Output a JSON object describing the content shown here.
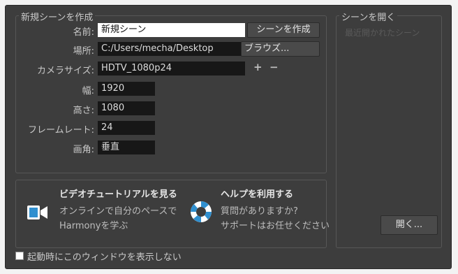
{
  "create_scene": {
    "group_title": "新規シーンを作成",
    "name_label": "名前:",
    "name_value": "新規シーン",
    "create_button": "シーンを作成",
    "location_label": "場所:",
    "location_value": "C:/Users/mecha/Desktop",
    "browse_button": "ブラウズ...",
    "camera_size_label": "カメラサイズ:",
    "camera_size_value": "HDTV_1080p24",
    "add_symbol": "+",
    "remove_symbol": "−",
    "width_label": "幅:",
    "width_value": "1920",
    "height_label": "高さ:",
    "height_value": "1080",
    "frame_rate_label": "フレームレート:",
    "frame_rate_value": "24",
    "angle_label": "画角:",
    "angle_value": "垂直"
  },
  "open_scene": {
    "group_title": "シーンを開く",
    "recent_label": "最近開かれたシーン",
    "open_button": "開く..."
  },
  "help": {
    "video_title": "ビデオチュートリアルを見る",
    "video_sub_1": "オンラインで自分のペースで",
    "video_sub_2": "Harmonyを学ぶ",
    "help_title": "ヘルプを利用する",
    "help_sub_1": "質問がありますか?",
    "help_sub_2": "サポートはお任せください"
  },
  "footer": {
    "checkbox_label": "起動時にこのウィンドウを表示しない"
  },
  "colors": {
    "dialog_bg": "#3d3d3d",
    "field_bg": "#171717",
    "accent_blue": "#2f8fcf"
  }
}
